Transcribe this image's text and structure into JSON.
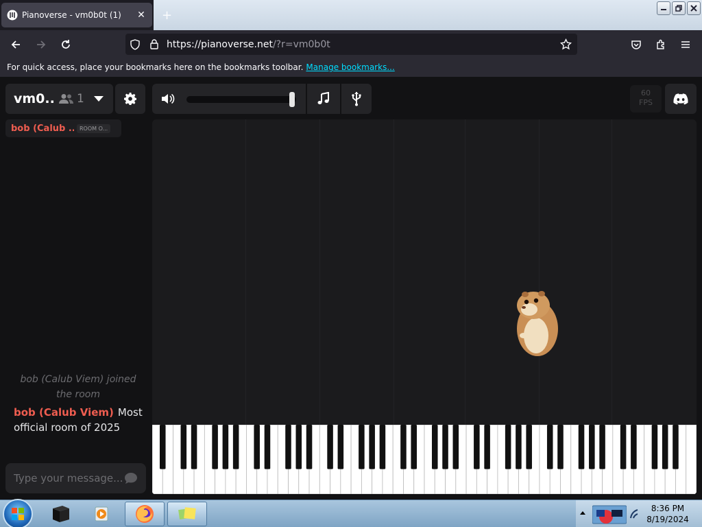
{
  "browser": {
    "tab_title": "Pianoverse - vm0b0t (1)",
    "tab_close": "✕",
    "new_tab": "+",
    "url_host": "https://pianoverse.net",
    "url_rest": "/?r=vm0b0t",
    "bookmarks_text": "For quick access, place your bookmarks here on the bookmarks toolbar.",
    "bookmarks_link": "Manage bookmarks..."
  },
  "room": {
    "name": "vm0...",
    "user_count": "1",
    "fps_value": "60",
    "fps_label": "FPS"
  },
  "users": [
    {
      "name": "bob (Calub ...",
      "tag": "ROOM O..."
    }
  ],
  "chat": {
    "system_message": "bob (Calub Viem) joined the room",
    "messages": [
      {
        "from": "bob (Calub Viem)",
        "text": "Most official room of 2025"
      }
    ],
    "input_placeholder": "Type your message..."
  },
  "volume": {
    "level_fraction": 1.0
  },
  "keyboard": {
    "white_keys": 52
  },
  "taskbar": {
    "time": "8:36 PM",
    "date": "8/19/2024"
  },
  "colors": {
    "accent_user": "#ef5d50",
    "link": "#00ddff",
    "page_bg": "#121214"
  }
}
